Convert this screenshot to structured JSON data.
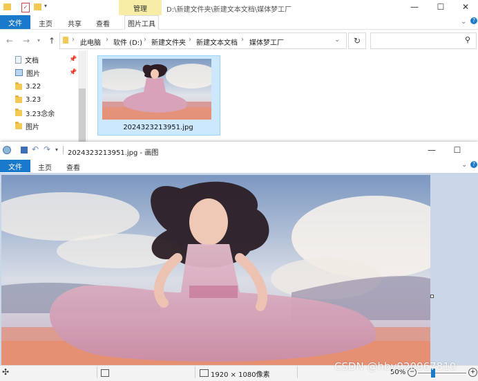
{
  "explorer": {
    "context_tab": "管理",
    "path_title": "D:\\新建文件夹\\新建文本文档\\媒体梦工厂",
    "ribbon_tabs": [
      "文件",
      "主页",
      "共享",
      "查看",
      "图片工具"
    ],
    "breadcrumb": [
      "此电脑",
      "软件 (D:)",
      "新建文件夹",
      "新建文本文档",
      "媒体梦工厂"
    ],
    "sidebar": [
      {
        "label": "文档",
        "icon": "document-icon",
        "pinned": true
      },
      {
        "label": "图片",
        "icon": "pictures-icon",
        "pinned": true
      },
      {
        "label": "3.22",
        "icon": "folder-icon",
        "pinned": false
      },
      {
        "label": "3.23",
        "icon": "folder-icon",
        "pinned": false
      },
      {
        "label": "3.23念余",
        "icon": "folder-icon",
        "pinned": false
      },
      {
        "label": "图片",
        "icon": "folder-icon",
        "pinned": false
      }
    ],
    "file": {
      "name": "2024323213951.jpg"
    }
  },
  "paint": {
    "title": "2024323213951.jpg - 画图",
    "tabs": [
      "文件",
      "主页",
      "查看"
    ],
    "status": {
      "dimensions": "1920 × 1080像素",
      "zoom": "50%"
    }
  },
  "watermark": "CSDN @hby920967810",
  "colors": {
    "accent": "#1979ca",
    "context_tab": "#f7eda6",
    "selection": "#cce8ff",
    "canvas_bg": "#cad7e8"
  }
}
